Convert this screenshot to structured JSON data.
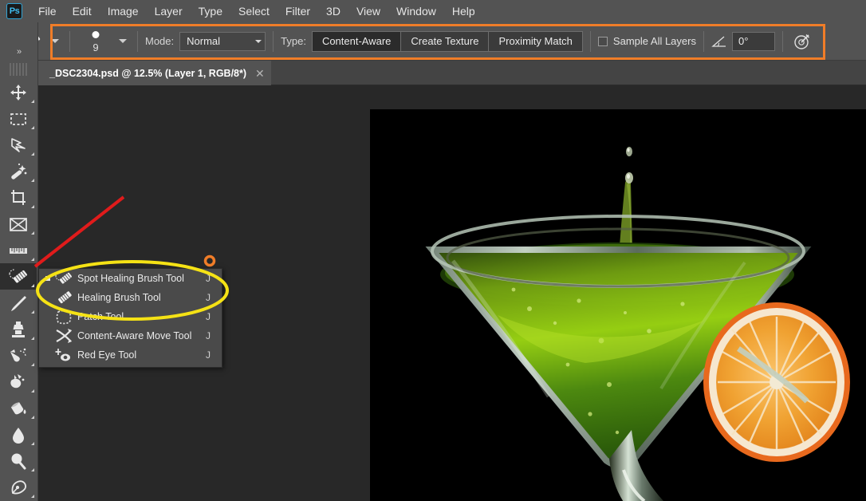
{
  "app": {
    "logo_text": "Ps",
    "menus": [
      "File",
      "Edit",
      "Image",
      "Layer",
      "Type",
      "Select",
      "Filter",
      "3D",
      "View",
      "Window",
      "Help"
    ]
  },
  "options_bar": {
    "brush_preview_icon": "spot-healing-brush-icon",
    "brush_size": "9",
    "mode_label": "Mode:",
    "mode_value": "Normal",
    "type_label": "Type:",
    "type_options": [
      "Content-Aware",
      "Create Texture",
      "Proximity Match"
    ],
    "type_selected": "Content-Aware",
    "sample_all_layers_label": "Sample All Layers",
    "sample_all_layers_checked": false,
    "angle_icon": "angle-icon",
    "angle_value": "0°",
    "airbrush_icon": "airbrush-pressure-icon",
    "highlight_color": "#f07d28"
  },
  "document": {
    "tab_title": "_DSC2304.psd @ 12.5% (Layer 1, RGB/8*)",
    "close_glyph": "✕",
    "zoom": "12.5%",
    "layer": "Layer 1",
    "mode": "RGB/8*"
  },
  "toolbar": {
    "collapse_glyph": "»",
    "tools": [
      {
        "name": "move-tool",
        "icon": "move-icon"
      },
      {
        "name": "rectangular-marquee-tool",
        "icon": "marquee-icon"
      },
      {
        "name": "lasso-tool",
        "icon": "lasso-icon"
      },
      {
        "name": "quick-selection-tool",
        "icon": "magic-wand-icon"
      },
      {
        "name": "crop-tool",
        "icon": "crop-icon"
      },
      {
        "name": "frame-tool",
        "icon": "frame-icon"
      },
      {
        "name": "eyedropper-tool",
        "icon": "eyedropper-ruler-icon"
      },
      {
        "name": "spot-healing-brush-tool",
        "icon": "healing-brush-icon"
      },
      {
        "name": "brush-tool",
        "icon": "paintbrush-icon"
      },
      {
        "name": "clone-stamp-tool",
        "icon": "clone-stamp-icon"
      },
      {
        "name": "history-brush-tool",
        "icon": "history-brush-icon"
      },
      {
        "name": "eraser-tool",
        "icon": "eraser-icon"
      },
      {
        "name": "gradient-tool",
        "icon": "paint-bucket-icon"
      },
      {
        "name": "blur-tool",
        "icon": "blur-drop-icon"
      },
      {
        "name": "dodge-tool",
        "icon": "dodge-icon"
      },
      {
        "name": "pen-tool",
        "icon": "pen-icon"
      }
    ],
    "selected_index": 7
  },
  "flyout_menu": {
    "items": [
      {
        "label": "Spot Healing Brush Tool",
        "shortcut": "J",
        "icon": "spot-healing-brush-icon",
        "current": true
      },
      {
        "label": "Healing Brush Tool",
        "shortcut": "J",
        "icon": "healing-brush-icon",
        "current": false
      },
      {
        "label": "Patch Tool",
        "shortcut": "J",
        "icon": "patch-icon",
        "current": false
      },
      {
        "label": "Content-Aware Move Tool",
        "shortcut": "J",
        "icon": "content-aware-move-icon",
        "current": false
      },
      {
        "label": "Red Eye Tool",
        "shortcut": "J",
        "icon": "red-eye-icon",
        "current": false
      }
    ]
  },
  "annotations": {
    "red_arrow_color": "#e01b1b",
    "yellow_ellipse_color": "#f5e215",
    "orange_circle_color": "#f07d28"
  },
  "canvas": {
    "image_description": "green martini cocktail with orange slice garnish on black background",
    "background_color": "#282828",
    "photo_background": "#000000"
  }
}
